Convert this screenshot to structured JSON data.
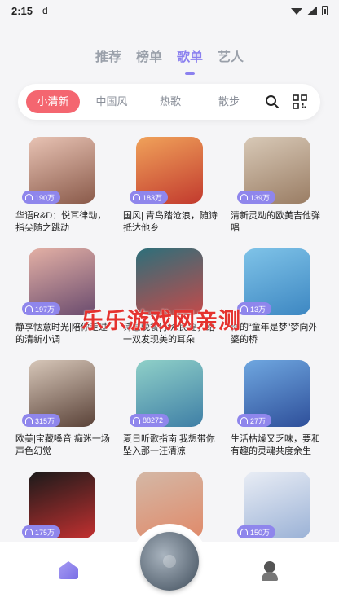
{
  "status": {
    "time": "2:15",
    "extra": "d"
  },
  "tabs": [
    {
      "label": "推荐",
      "active": false
    },
    {
      "label": "榜单",
      "active": false
    },
    {
      "label": "歌单",
      "active": true
    },
    {
      "label": "艺人",
      "active": false
    }
  ],
  "filters": [
    {
      "label": "小清新",
      "active": true
    },
    {
      "label": "中国风",
      "active": false
    },
    {
      "label": "热歌",
      "active": false
    },
    {
      "label": "散步",
      "active": false
    }
  ],
  "playlists": [
    {
      "plays": "190万",
      "title": "华语R&D：悦耳律动，指尖随之跳动",
      "cover": [
        "#e8c3b4",
        "#8a5a4a"
      ]
    },
    {
      "plays": "183万",
      "title": "国风| 青鸟踏沧浪，随诗抵达他乡",
      "cover": [
        "#f0a25a",
        "#c23a2e"
      ]
    },
    {
      "plays": "139万",
      "title": "清新灵动的欧美吉他弹唱",
      "cover": [
        "#d8c9b7",
        "#9a7d64"
      ]
    },
    {
      "plays": "197万",
      "title": "静享惬意时光|陪你走过的清新小调",
      "cover": [
        "#e3b0a5",
        "#6a4b6e"
      ]
    },
    {
      "plays": "",
      "title": "诗意晚餐|小众民谣，给一双发现美的耳朵",
      "cover": [
        "#2d6f7a",
        "#c44a4a"
      ]
    },
    {
      "plays": "13万",
      "title": "你的“童年是梦”梦向外婆的桥",
      "cover": [
        "#7fc3e8",
        "#3d87c2"
      ]
    },
    {
      "plays": "315万",
      "title": "欧美|宝藏嗓音 痴迷一场声色幻觉",
      "cover": [
        "#d7c7b9",
        "#5a4238"
      ]
    },
    {
      "plays": "88272",
      "title": "夏日听歌指南|我想带你坠入那一汪清凉",
      "cover": [
        "#8fd0c8",
        "#3f7fa6"
      ]
    },
    {
      "plays": "27万",
      "title": "生活枯燥又乏味，要和有趣的灵魂共度余生",
      "cover": [
        "#6fa7e0",
        "#2e4f9a"
      ]
    },
    {
      "plays": "175万",
      "title": "",
      "cover": [
        "#1a1a1a",
        "#c23030"
      ]
    },
    {
      "plays": "",
      "title": "",
      "cover": [
        "#d4b8a6",
        "#e08a6a"
      ]
    },
    {
      "plays": "150万",
      "title": "",
      "cover": [
        "#e9edf5",
        "#9bb2d6"
      ]
    }
  ],
  "watermark": "乐乐游戏网亲测",
  "colors": {
    "accent": "#8b80ef",
    "chip_active": "#f46670"
  },
  "icons": [
    "search-icon",
    "qr-scan-icon",
    "headphones-icon",
    "home-icon",
    "profile-icon"
  ]
}
